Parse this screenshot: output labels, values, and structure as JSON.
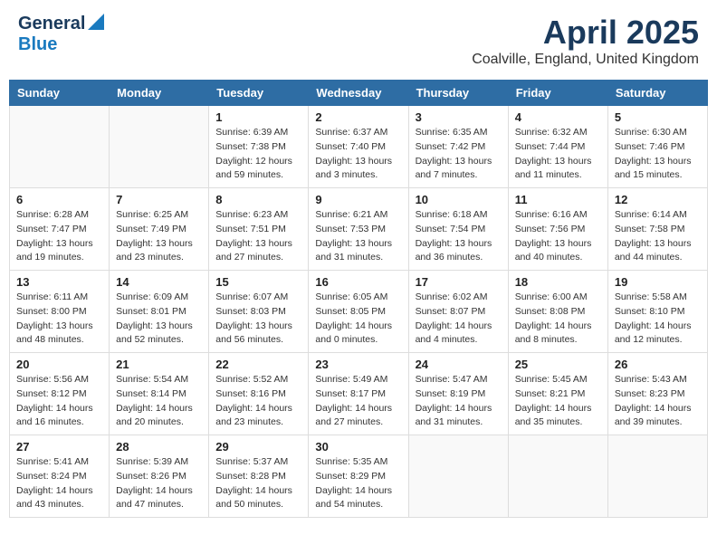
{
  "logo": {
    "general": "General",
    "blue": "Blue"
  },
  "title": "April 2025",
  "subtitle": "Coalville, England, United Kingdom",
  "weekdays": [
    "Sunday",
    "Monday",
    "Tuesday",
    "Wednesday",
    "Thursday",
    "Friday",
    "Saturday"
  ],
  "weeks": [
    [
      {
        "day": "",
        "sunrise": "",
        "sunset": "",
        "daylight": ""
      },
      {
        "day": "",
        "sunrise": "",
        "sunset": "",
        "daylight": ""
      },
      {
        "day": "1",
        "sunrise": "Sunrise: 6:39 AM",
        "sunset": "Sunset: 7:38 PM",
        "daylight": "Daylight: 12 hours and 59 minutes."
      },
      {
        "day": "2",
        "sunrise": "Sunrise: 6:37 AM",
        "sunset": "Sunset: 7:40 PM",
        "daylight": "Daylight: 13 hours and 3 minutes."
      },
      {
        "day": "3",
        "sunrise": "Sunrise: 6:35 AM",
        "sunset": "Sunset: 7:42 PM",
        "daylight": "Daylight: 13 hours and 7 minutes."
      },
      {
        "day": "4",
        "sunrise": "Sunrise: 6:32 AM",
        "sunset": "Sunset: 7:44 PM",
        "daylight": "Daylight: 13 hours and 11 minutes."
      },
      {
        "day": "5",
        "sunrise": "Sunrise: 6:30 AM",
        "sunset": "Sunset: 7:46 PM",
        "daylight": "Daylight: 13 hours and 15 minutes."
      }
    ],
    [
      {
        "day": "6",
        "sunrise": "Sunrise: 6:28 AM",
        "sunset": "Sunset: 7:47 PM",
        "daylight": "Daylight: 13 hours and 19 minutes."
      },
      {
        "day": "7",
        "sunrise": "Sunrise: 6:25 AM",
        "sunset": "Sunset: 7:49 PM",
        "daylight": "Daylight: 13 hours and 23 minutes."
      },
      {
        "day": "8",
        "sunrise": "Sunrise: 6:23 AM",
        "sunset": "Sunset: 7:51 PM",
        "daylight": "Daylight: 13 hours and 27 minutes."
      },
      {
        "day": "9",
        "sunrise": "Sunrise: 6:21 AM",
        "sunset": "Sunset: 7:53 PM",
        "daylight": "Daylight: 13 hours and 31 minutes."
      },
      {
        "day": "10",
        "sunrise": "Sunrise: 6:18 AM",
        "sunset": "Sunset: 7:54 PM",
        "daylight": "Daylight: 13 hours and 36 minutes."
      },
      {
        "day": "11",
        "sunrise": "Sunrise: 6:16 AM",
        "sunset": "Sunset: 7:56 PM",
        "daylight": "Daylight: 13 hours and 40 minutes."
      },
      {
        "day": "12",
        "sunrise": "Sunrise: 6:14 AM",
        "sunset": "Sunset: 7:58 PM",
        "daylight": "Daylight: 13 hours and 44 minutes."
      }
    ],
    [
      {
        "day": "13",
        "sunrise": "Sunrise: 6:11 AM",
        "sunset": "Sunset: 8:00 PM",
        "daylight": "Daylight: 13 hours and 48 minutes."
      },
      {
        "day": "14",
        "sunrise": "Sunrise: 6:09 AM",
        "sunset": "Sunset: 8:01 PM",
        "daylight": "Daylight: 13 hours and 52 minutes."
      },
      {
        "day": "15",
        "sunrise": "Sunrise: 6:07 AM",
        "sunset": "Sunset: 8:03 PM",
        "daylight": "Daylight: 13 hours and 56 minutes."
      },
      {
        "day": "16",
        "sunrise": "Sunrise: 6:05 AM",
        "sunset": "Sunset: 8:05 PM",
        "daylight": "Daylight: 14 hours and 0 minutes."
      },
      {
        "day": "17",
        "sunrise": "Sunrise: 6:02 AM",
        "sunset": "Sunset: 8:07 PM",
        "daylight": "Daylight: 14 hours and 4 minutes."
      },
      {
        "day": "18",
        "sunrise": "Sunrise: 6:00 AM",
        "sunset": "Sunset: 8:08 PM",
        "daylight": "Daylight: 14 hours and 8 minutes."
      },
      {
        "day": "19",
        "sunrise": "Sunrise: 5:58 AM",
        "sunset": "Sunset: 8:10 PM",
        "daylight": "Daylight: 14 hours and 12 minutes."
      }
    ],
    [
      {
        "day": "20",
        "sunrise": "Sunrise: 5:56 AM",
        "sunset": "Sunset: 8:12 PM",
        "daylight": "Daylight: 14 hours and 16 minutes."
      },
      {
        "day": "21",
        "sunrise": "Sunrise: 5:54 AM",
        "sunset": "Sunset: 8:14 PM",
        "daylight": "Daylight: 14 hours and 20 minutes."
      },
      {
        "day": "22",
        "sunrise": "Sunrise: 5:52 AM",
        "sunset": "Sunset: 8:16 PM",
        "daylight": "Daylight: 14 hours and 23 minutes."
      },
      {
        "day": "23",
        "sunrise": "Sunrise: 5:49 AM",
        "sunset": "Sunset: 8:17 PM",
        "daylight": "Daylight: 14 hours and 27 minutes."
      },
      {
        "day": "24",
        "sunrise": "Sunrise: 5:47 AM",
        "sunset": "Sunset: 8:19 PM",
        "daylight": "Daylight: 14 hours and 31 minutes."
      },
      {
        "day": "25",
        "sunrise": "Sunrise: 5:45 AM",
        "sunset": "Sunset: 8:21 PM",
        "daylight": "Daylight: 14 hours and 35 minutes."
      },
      {
        "day": "26",
        "sunrise": "Sunrise: 5:43 AM",
        "sunset": "Sunset: 8:23 PM",
        "daylight": "Daylight: 14 hours and 39 minutes."
      }
    ],
    [
      {
        "day": "27",
        "sunrise": "Sunrise: 5:41 AM",
        "sunset": "Sunset: 8:24 PM",
        "daylight": "Daylight: 14 hours and 43 minutes."
      },
      {
        "day": "28",
        "sunrise": "Sunrise: 5:39 AM",
        "sunset": "Sunset: 8:26 PM",
        "daylight": "Daylight: 14 hours and 47 minutes."
      },
      {
        "day": "29",
        "sunrise": "Sunrise: 5:37 AM",
        "sunset": "Sunset: 8:28 PM",
        "daylight": "Daylight: 14 hours and 50 minutes."
      },
      {
        "day": "30",
        "sunrise": "Sunrise: 5:35 AM",
        "sunset": "Sunset: 8:29 PM",
        "daylight": "Daylight: 14 hours and 54 minutes."
      },
      {
        "day": "",
        "sunrise": "",
        "sunset": "",
        "daylight": ""
      },
      {
        "day": "",
        "sunrise": "",
        "sunset": "",
        "daylight": ""
      },
      {
        "day": "",
        "sunrise": "",
        "sunset": "",
        "daylight": ""
      }
    ]
  ]
}
